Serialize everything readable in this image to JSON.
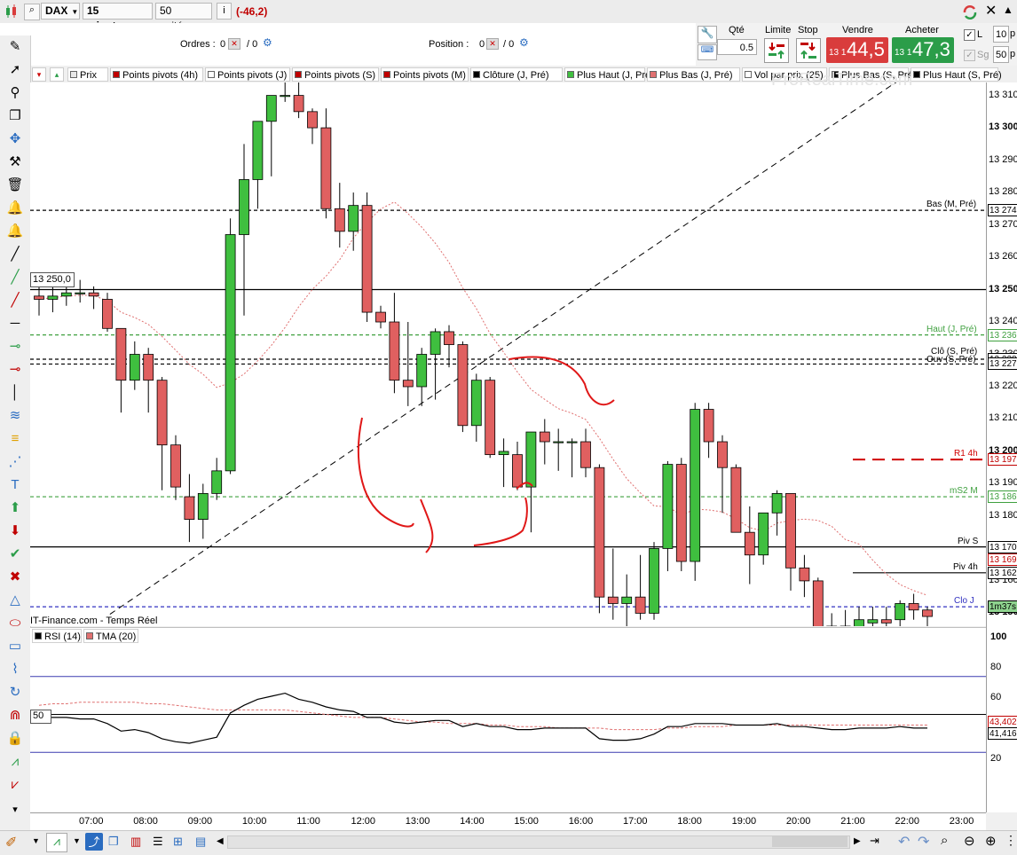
{
  "toolbar": {
    "instrument": "DAX",
    "timeframe": "15 minutes",
    "units": "50 unités",
    "info_icon": "i",
    "change": "(-46,2)"
  },
  "orders": {
    "ordres_label": "Ordres :",
    "ordres_count": "0",
    "ordres_sep": "/ 0",
    "position_label": "Position :",
    "position_count": "0",
    "position_sep": "/ 0"
  },
  "trade_panel": {
    "qty_label": "Qté",
    "qty_value": "0.5",
    "limit_label": "Limite",
    "stop_label": "Stop",
    "sell_label": "Vendre",
    "sell_price_small": "13 1",
    "sell_price_big": "44,5",
    "buy_label": "Acheter",
    "buy_price_small": "13 1",
    "buy_price_big": "47,3",
    "check_l": "L",
    "check_sg": "Sg",
    "input_top": "10",
    "input_top_suffix": "p",
    "input_bottom": "50",
    "input_bottom_suffix": "p"
  },
  "legend": [
    {
      "label": "Prix",
      "color": "#e8e8e8"
    },
    {
      "label": "Points pivots (4h)",
      "color": "#c00000"
    },
    {
      "label": "Points pivots (J)",
      "color": "#ffffff"
    },
    {
      "label": "Points pivots (S)",
      "color": "#c00000"
    },
    {
      "label": "Points pivots (M)",
      "color": "#c00000"
    },
    {
      "label": "Clôture (J, Pré)",
      "color": "#000000"
    },
    {
      "label": "Plus Haut (J, Pré)",
      "color": "#3fbf3f"
    },
    {
      "label": "Plus Bas (J, Pré)",
      "color": "#e07070"
    },
    {
      "label": "Vol par prix (25)",
      "color": "#ffffff"
    },
    {
      "label": "Plus Bas (S, Pré)",
      "color": "#000000"
    },
    {
      "label": "Plus Haut (S, Pré)",
      "color": "#000000"
    }
  ],
  "watermark": "ProRealTime.com",
  "price_axis": {
    "ticks": [
      "13 310",
      "13 300",
      "13 290",
      "13 280",
      "13 270",
      "13 260",
      "13 250",
      "13 240",
      "13 230",
      "13 220",
      "13 210",
      "13 200",
      "13 190",
      "13 180",
      "13 170",
      "13 160",
      "13 150"
    ],
    "badges": [
      {
        "text": "13 274",
        "value": 13274.5
      },
      {
        "text": "13 236",
        "value": 13236
      },
      {
        "text": "13 228",
        "value": 13228.5
      },
      {
        "text": "13 227",
        "value": 13227
      },
      {
        "text": "13 197",
        "value": 13197.5
      },
      {
        "text": "13 186",
        "value": 13186
      },
      {
        "text": "13 170",
        "value": 13170.5
      },
      {
        "text": "13 169",
        "value": 13166.5
      },
      {
        "text": "13 162",
        "value": 13162.5
      },
      {
        "text": "1m37s",
        "value": 13152
      }
    ]
  },
  "levels": [
    {
      "label": "Bas (M, Pré)",
      "value": 13274.5,
      "style": "dashed",
      "color": "#000000"
    },
    {
      "label": "Haut (J, Pré)",
      "value": 13236,
      "style": "dashed",
      "color": "#3fa03f"
    },
    {
      "label": "Clô (S, Pré)",
      "value": 13228.5,
      "style": "dashed",
      "color": "#000000"
    },
    {
      "label": "Ouv (S, Pré)",
      "value": 13227,
      "style": "dashed",
      "color": "#000000"
    },
    {
      "label": "R1 4h",
      "value": 13197.5,
      "style": "dashed",
      "color": "#d00000"
    },
    {
      "label": "mS2 M",
      "value": 13186,
      "style": "dashed",
      "color": "#3fa03f"
    },
    {
      "label": "Piv S",
      "value": 13170.5,
      "style": "solid",
      "color": "#000000"
    },
    {
      "label": "Piv 4h",
      "value": 13162.5,
      "style": "solid",
      "color": "#000000"
    },
    {
      "label": "Clo J",
      "value": 13152,
      "style": "dashed",
      "color": "#3030c0"
    }
  ],
  "price_label_box": "13 250,0",
  "source_label": "IT-Finance.com - Temps Réel",
  "chart_data": {
    "type": "candlestick",
    "x_labels": [
      "07:00",
      "08:00",
      "09:00",
      "10:00",
      "11:00",
      "12:00",
      "13:00",
      "14:00",
      "15:00",
      "16:00",
      "17:00",
      "18:00",
      "19:00",
      "20:00",
      "21:00",
      "22:00",
      "23:00"
    ],
    "candles": [
      {
        "o": 13248,
        "h": 13251,
        "l": 13242,
        "c": 13247
      },
      {
        "o": 13247,
        "h": 13252,
        "l": 13243,
        "c": 13248
      },
      {
        "o": 13248,
        "h": 13252,
        "l": 13245,
        "c": 13249
      },
      {
        "o": 13249,
        "h": 13253,
        "l": 13246,
        "c": 13249
      },
      {
        "o": 13249,
        "h": 13251,
        "l": 13244,
        "c": 13248
      },
      {
        "o": 13247,
        "h": 13249,
        "l": 13237,
        "c": 13238
      },
      {
        "o": 13238,
        "h": 13238,
        "l": 13212,
        "c": 13222
      },
      {
        "o": 13222,
        "h": 13234,
        "l": 13219,
        "c": 13230
      },
      {
        "o": 13230,
        "h": 13232,
        "l": 13212,
        "c": 13222
      },
      {
        "o": 13222,
        "h": 13223,
        "l": 13188,
        "c": 13202
      },
      {
        "o": 13202,
        "h": 13205,
        "l": 13185,
        "c": 13189
      },
      {
        "o": 13186,
        "h": 13193,
        "l": 13172,
        "c": 13179
      },
      {
        "o": 13179,
        "h": 13190,
        "l": 13173,
        "c": 13187
      },
      {
        "o": 13187,
        "h": 13198,
        "l": 13185,
        "c": 13194
      },
      {
        "o": 13194,
        "h": 13272,
        "l": 13193,
        "c": 13267
      },
      {
        "o": 13267,
        "h": 13295,
        "l": 13242,
        "c": 13284
      },
      {
        "o": 13284,
        "h": 13300,
        "l": 13275,
        "c": 13302
      },
      {
        "o": 13302,
        "h": 13310,
        "l": 13285,
        "c": 13310
      },
      {
        "o": 13310,
        "h": 13315,
        "l": 13308,
        "c": 13310
      },
      {
        "o": 13310,
        "h": 13315,
        "l": 13303,
        "c": 13305
      },
      {
        "o": 13305,
        "h": 13306,
        "l": 13295,
        "c": 13300
      },
      {
        "o": 13300,
        "h": 13306,
        "l": 13272,
        "c": 13275
      },
      {
        "o": 13275,
        "h": 13283,
        "l": 13263,
        "c": 13268
      },
      {
        "o": 13268,
        "h": 13280,
        "l": 13262,
        "c": 13276
      },
      {
        "o": 13276,
        "h": 13280,
        "l": 13240,
        "c": 13243
      },
      {
        "o": 13243,
        "h": 13245,
        "l": 13238,
        "c": 13240
      },
      {
        "o": 13240,
        "h": 13249,
        "l": 13218,
        "c": 13222
      },
      {
        "o": 13222,
        "h": 13240,
        "l": 13214,
        "c": 13220
      },
      {
        "o": 13220,
        "h": 13232,
        "l": 13214,
        "c": 13230
      },
      {
        "o": 13230,
        "h": 13238,
        "l": 13216,
        "c": 13237
      },
      {
        "o": 13237,
        "h": 13239,
        "l": 13226,
        "c": 13233
      },
      {
        "o": 13233,
        "h": 13234,
        "l": 13206,
        "c": 13208
      },
      {
        "o": 13208,
        "h": 13224,
        "l": 13203,
        "c": 13222
      },
      {
        "o": 13222,
        "h": 13223,
        "l": 13198,
        "c": 13199
      },
      {
        "o": 13199,
        "h": 13204,
        "l": 13189,
        "c": 13200
      },
      {
        "o": 13199,
        "h": 13203,
        "l": 13188,
        "c": 13189
      },
      {
        "o": 13189,
        "h": 13206,
        "l": 13175,
        "c": 13206
      },
      {
        "o": 13206,
        "h": 13210,
        "l": 13196,
        "c": 13203
      },
      {
        "o": 13203,
        "h": 13207,
        "l": 13194,
        "c": 13203
      },
      {
        "o": 13203,
        "h": 13204,
        "l": 13192,
        "c": 13203
      },
      {
        "o": 13203,
        "h": 13207,
        "l": 13192,
        "c": 13195
      },
      {
        "o": 13195,
        "h": 13196,
        "l": 13150,
        "c": 13155
      },
      {
        "o": 13155,
        "h": 13170,
        "l": 13148,
        "c": 13153
      },
      {
        "o": 13153,
        "h": 13162,
        "l": 13145,
        "c": 13155
      },
      {
        "o": 13155,
        "h": 13168,
        "l": 13148,
        "c": 13150
      },
      {
        "o": 13150,
        "h": 13172,
        "l": 13148,
        "c": 13170
      },
      {
        "o": 13170,
        "h": 13197,
        "l": 13163,
        "c": 13196
      },
      {
        "o": 13196,
        "h": 13198,
        "l": 13163,
        "c": 13166
      },
      {
        "o": 13166,
        "h": 13215,
        "l": 13160,
        "c": 13213
      },
      {
        "o": 13213,
        "h": 13215,
        "l": 13198,
        "c": 13203
      },
      {
        "o": 13203,
        "h": 13205,
        "l": 13181,
        "c": 13195
      },
      {
        "o": 13195,
        "h": 13196,
        "l": 13177,
        "c": 13175
      },
      {
        "o": 13175,
        "h": 13183,
        "l": 13159,
        "c": 13168
      },
      {
        "o": 13168,
        "h": 13181,
        "l": 13165,
        "c": 13181
      },
      {
        "o": 13181,
        "h": 13188,
        "l": 13174,
        "c": 13187
      },
      {
        "o": 13187,
        "h": 13187,
        "l": 13157,
        "c": 13164
      },
      {
        "o": 13164,
        "h": 13168,
        "l": 13155,
        "c": 13160
      },
      {
        "o": 13160,
        "h": 13161,
        "l": 13147,
        "c": 13145
      },
      {
        "o": 13145,
        "h": 13150,
        "l": 13143,
        "c": 13146
      },
      {
        "o": 13146,
        "h": 13151,
        "l": 13141,
        "c": 13143
      },
      {
        "o": 13143,
        "h": 13152,
        "l": 13144,
        "c": 13148
      },
      {
        "o": 13147,
        "h": 13152,
        "l": 13145,
        "c": 13148
      },
      {
        "o": 13148,
        "h": 13152,
        "l": 13145,
        "c": 13147
      },
      {
        "o": 13148,
        "h": 13154,
        "l": 13146,
        "c": 13153
      },
      {
        "o": 13153,
        "h": 13156,
        "l": 13148,
        "c": 13151
      },
      {
        "o": 13151,
        "h": 13152,
        "l": 13146,
        "c": 13149
      }
    ],
    "ylim": [
      13146,
      13314
    ]
  },
  "rsi_panel": {
    "legend": [
      {
        "label": "RSI (14)",
        "color": "#000000"
      },
      {
        "label": "TMA (20)",
        "color": "#e07070"
      }
    ],
    "ticks": [
      "100",
      "80",
      "60",
      "40",
      "20"
    ],
    "badges": [
      "43,402",
      "41,416"
    ],
    "mid_label": "50",
    "ylim": [
      0,
      100
    ],
    "rsi": [
      48,
      48,
      48,
      47,
      47,
      44,
      39,
      40,
      38,
      34,
      32,
      31,
      33,
      35,
      51,
      56,
      60,
      62,
      64,
      60,
      58,
      55,
      53,
      52,
      48,
      48,
      45,
      44,
      45,
      46,
      46,
      42,
      44,
      42,
      42,
      40,
      40,
      41,
      41,
      41,
      41,
      34,
      33,
      33,
      34,
      37,
      42,
      42,
      44,
      44,
      44,
      43,
      43,
      43,
      44,
      42,
      42,
      41,
      40,
      40,
      41,
      41,
      41,
      42,
      41,
      41
    ],
    "tma": [
      56,
      57,
      57,
      58,
      58,
      58,
      58,
      58,
      57,
      57,
      56,
      55,
      54,
      53,
      53,
      53,
      53,
      53,
      53,
      52,
      51,
      50,
      49,
      48,
      48,
      48,
      47,
      46,
      45,
      45,
      44,
      44,
      44,
      43,
      43,
      42,
      42,
      42,
      41,
      41,
      41,
      41,
      40,
      40,
      40,
      40,
      41,
      41,
      42,
      42,
      42,
      43,
      43,
      43,
      43,
      43,
      43,
      43,
      43,
      43,
      43,
      43,
      43,
      43,
      43,
      43
    ]
  },
  "x_axis": [
    "07:00",
    "08:00",
    "09:00",
    "10:00",
    "11:00",
    "12:00",
    "13:00",
    "14:00",
    "15:00",
    "16:00",
    "17:00",
    "18:00",
    "19:00",
    "20:00",
    "21:00",
    "22:00",
    "23:00"
  ],
  "colors": {
    "up": "#3fbf3f",
    "down": "#e06060",
    "sell": "#d93c3c",
    "buy": "#2b9d49",
    "change": "#c00000"
  }
}
